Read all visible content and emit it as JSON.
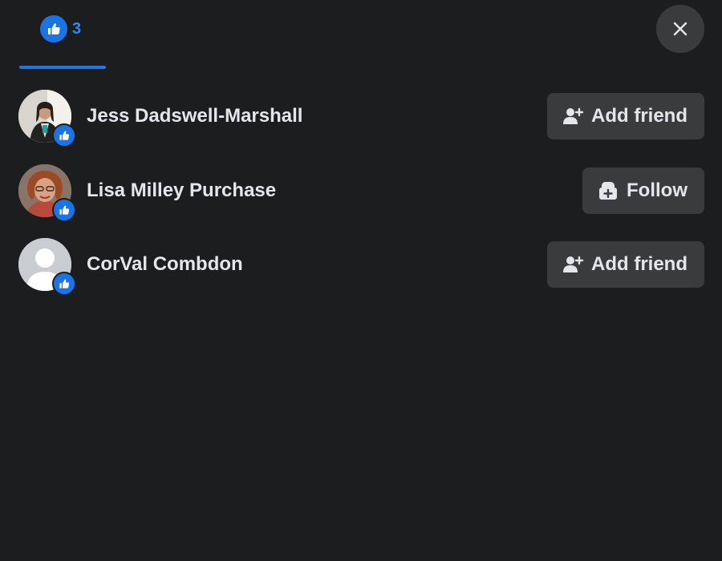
{
  "header": {
    "tabs": [
      {
        "icon": "like-icon",
        "count": "3",
        "active": true
      }
    ],
    "close_icon": "close-icon"
  },
  "people": [
    {
      "name": "Jess Dadswell-Marshall",
      "reaction": "like-icon",
      "action": {
        "label": "Add friend",
        "icon": "add-friend-icon"
      }
    },
    {
      "name": "Lisa Milley Purchase",
      "reaction": "like-icon",
      "action": {
        "label": "Follow",
        "icon": "follow-icon"
      }
    },
    {
      "name": "CorVal Combdon",
      "reaction": "like-icon",
      "action": {
        "label": "Add friend",
        "icon": "add-friend-icon"
      }
    }
  ],
  "colors": {
    "background": "#1c1d1f",
    "accent": "#2374e1",
    "like_blue": "#1b74e4",
    "button_bg": "#3a3b3c",
    "text": "#e4e6eb"
  }
}
